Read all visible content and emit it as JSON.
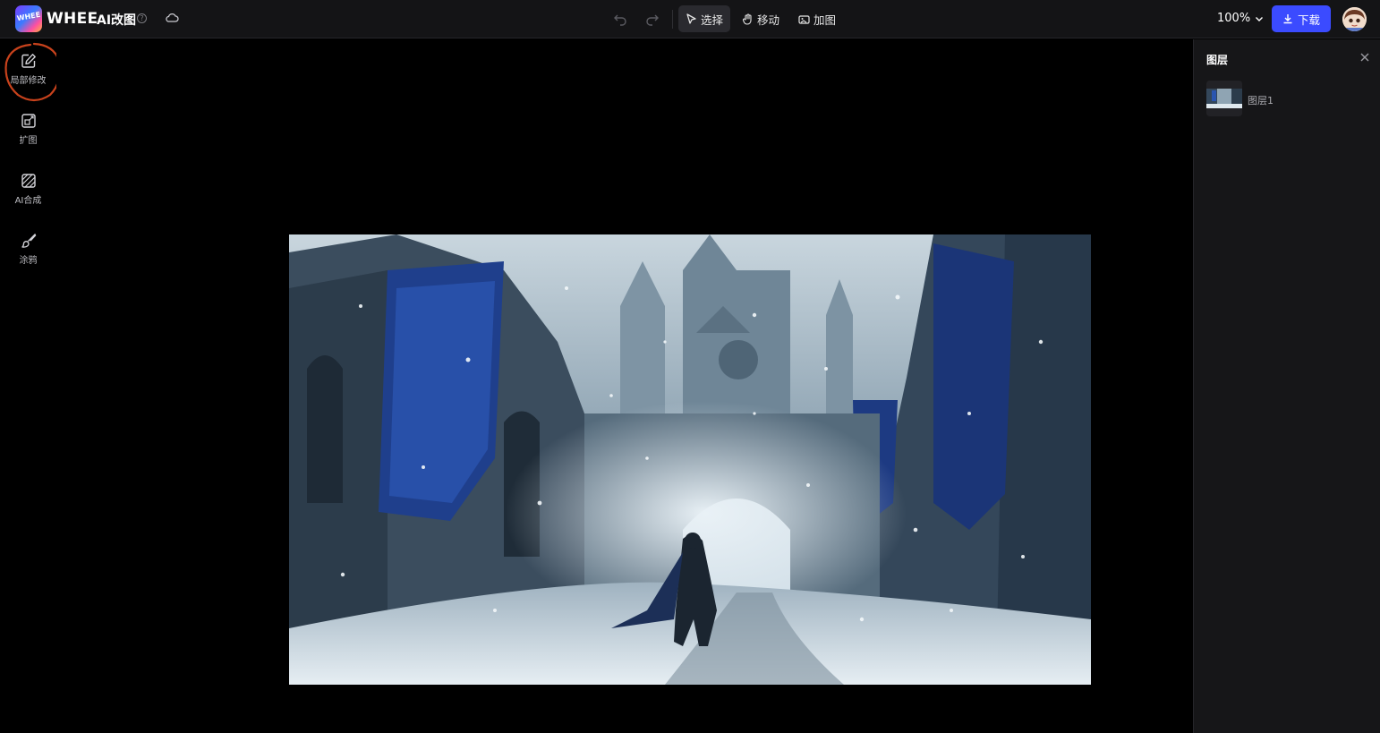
{
  "header": {
    "logo_text": "WHEE",
    "brand": "WHEE",
    "app_title": "AI改图",
    "help_glyph": "?",
    "tools": {
      "select": "选择",
      "move": "移动",
      "add_image": "加图"
    },
    "zoom": "100%",
    "download": "下载"
  },
  "left_tools": [
    {
      "label": "局部修改",
      "icon": "edit-icon"
    },
    {
      "label": "扩图",
      "icon": "expand-icon"
    },
    {
      "label": "AI合成",
      "icon": "ai-compose-icon"
    },
    {
      "label": "涂鸦",
      "icon": "brush-icon"
    }
  ],
  "layers_panel": {
    "title": "图层",
    "layers": [
      {
        "name": "图层1"
      }
    ]
  },
  "colors": {
    "accent": "#3b4bff",
    "annotation": "#c8421c"
  }
}
